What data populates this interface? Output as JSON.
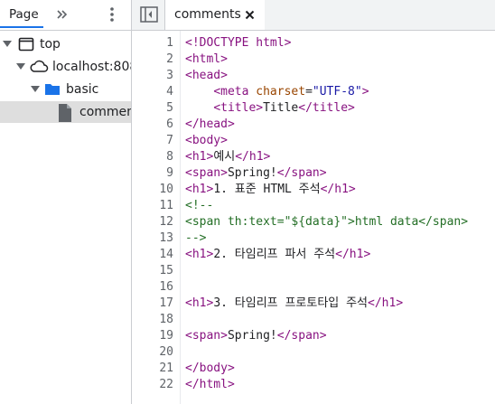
{
  "left_panel": {
    "tab_label": "Page",
    "tree": [
      {
        "label": "top",
        "icon": "frame-icon",
        "level": 0,
        "expanded": true
      },
      {
        "label": "localhost:808",
        "icon": "cloud-icon",
        "level": 1,
        "expanded": true
      },
      {
        "label": "basic",
        "icon": "folder-icon",
        "level": 2,
        "expanded": true
      },
      {
        "label": "commen",
        "icon": "file-icon",
        "level": 3,
        "selected": true
      }
    ]
  },
  "editor": {
    "tab_label": "comments",
    "lines": [
      {
        "n": "1",
        "code": "<!DOCTYPE html>"
      },
      {
        "n": "2",
        "code": "<html>"
      },
      {
        "n": "3",
        "code": "<head>"
      },
      {
        "n": "4",
        "code": "    <meta charset=\"UTF-8\">"
      },
      {
        "n": "5",
        "code": "    <title>Title</title>"
      },
      {
        "n": "6",
        "code": "</head>"
      },
      {
        "n": "7",
        "code": "<body>"
      },
      {
        "n": "8",
        "code": "<h1>예시</h1>"
      },
      {
        "n": "9",
        "code": "<span>Spring!</span>"
      },
      {
        "n": "10",
        "code": "<h1>1. 표준 HTML 주석</h1>"
      },
      {
        "n": "11",
        "code": "<!--"
      },
      {
        "n": "12",
        "code": "<span th:text=\"${data}\">html data</span>"
      },
      {
        "n": "13",
        "code": "-->"
      },
      {
        "n": "14",
        "code": "<h1>2. 타임리프 파서 주석</h1>"
      },
      {
        "n": "15",
        "code": ""
      },
      {
        "n": "16",
        "code": ""
      },
      {
        "n": "17",
        "code": "<h1>3. 타임리프 프로토타입 주석</h1>"
      },
      {
        "n": "18",
        "code": ""
      },
      {
        "n": "19",
        "code": "<span>Spring!</span>"
      },
      {
        "n": "20",
        "code": ""
      },
      {
        "n": "21",
        "code": "</body>"
      },
      {
        "n": "22",
        "code": "</html>"
      }
    ]
  },
  "colors": {
    "tag": "#881280",
    "attribute": "#994500",
    "value": "#1a1aa6",
    "comment": "#236e25",
    "selection": "#dedede",
    "accent": "#1a73e8"
  }
}
